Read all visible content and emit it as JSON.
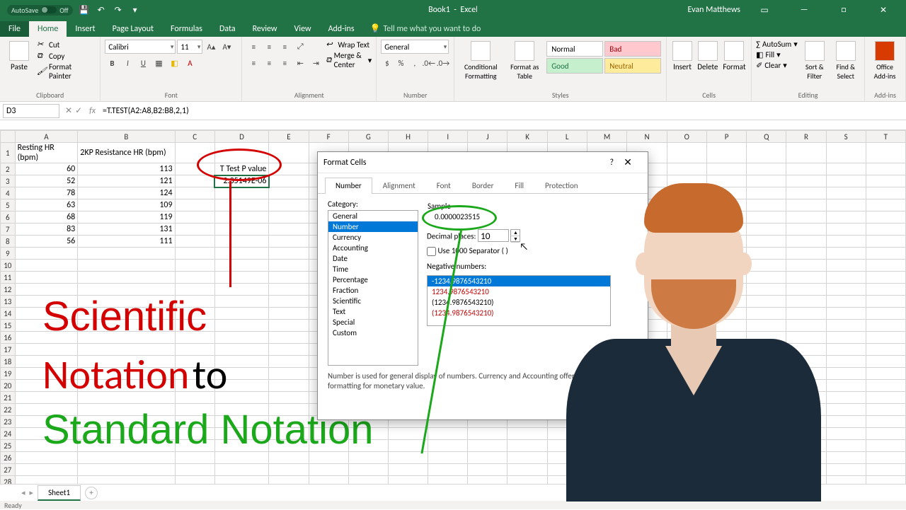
{
  "title": {
    "doc": "Book1",
    "app": "Excel",
    "user": "Evan Matthews",
    "autosave": "AutoSave",
    "autosave_state": "Off"
  },
  "tabs": {
    "file": "File",
    "home": "Home",
    "insert": "Insert",
    "pagelayout": "Page Layout",
    "formulas": "Formulas",
    "data": "Data",
    "review": "Review",
    "view": "View",
    "addins": "Add-ins",
    "tellme": "Tell me what you want to do"
  },
  "ribbon": {
    "clipboard": {
      "paste": "Paste",
      "cut": "Cut",
      "copy": "Copy",
      "painter": "Format Painter",
      "label": "Clipboard"
    },
    "font": {
      "name": "Calibri",
      "size": "11",
      "label": "Font"
    },
    "alignment": {
      "wrap": "Wrap Text",
      "merge": "Merge & Center",
      "label": "Alignment"
    },
    "number": {
      "format": "General",
      "label": "Number"
    },
    "styles": {
      "cond": "Conditional Formatting",
      "table": "Format as Table",
      "normal": "Normal",
      "bad": "Bad",
      "good": "Good",
      "neutral": "Neutral",
      "label": "Styles"
    },
    "cells": {
      "insert": "Insert",
      "delete": "Delete",
      "format": "Format",
      "label": "Cells"
    },
    "editing": {
      "autosum": "AutoSum",
      "fill": "Fill",
      "clear": "Clear",
      "sort": "Sort & Filter",
      "find": "Find & Select",
      "label": "Editing"
    },
    "addins": {
      "office": "Office Add-ins",
      "label": "Add-ins"
    }
  },
  "namebox": "D3",
  "formula": "=T.TEST(A2:A8,B2:B8,2,1)",
  "columns": [
    "A",
    "B",
    "C",
    "D",
    "E",
    "F",
    "G",
    "H",
    "I",
    "J",
    "K",
    "L",
    "M",
    "N",
    "O",
    "P",
    "Q",
    "R",
    "S",
    "T"
  ],
  "hdrA": "Resting HR (bpm)",
  "hdrB": "2KP Resistance HR (bpm)",
  "d2": "T Test P value",
  "d3": "2.35149E-06",
  "rows": [
    {
      "a": "60",
      "b": "113"
    },
    {
      "a": "52",
      "b": "121"
    },
    {
      "a": "78",
      "b": "124"
    },
    {
      "a": "63",
      "b": "109"
    },
    {
      "a": "68",
      "b": "119"
    },
    {
      "a": "83",
      "b": "131"
    },
    {
      "a": "56",
      "b": "111"
    }
  ],
  "dialog": {
    "title": "Format Cells",
    "tabs": {
      "number": "Number",
      "alignment": "Alignment",
      "font": "Font",
      "border": "Border",
      "fill": "Fill",
      "protection": "Protection"
    },
    "category_label": "Category:",
    "categories": [
      "General",
      "Number",
      "Currency",
      "Accounting",
      "Date",
      "Time",
      "Percentage",
      "Fraction",
      "Scientific",
      "Text",
      "Special",
      "Custom"
    ],
    "selected_category": "Number",
    "sample_label": "Sample",
    "sample_value": "0.0000023515",
    "decimal_label": "Decimal places:",
    "decimal_value": "10",
    "sep_label": "Use 1000 Separator ( )",
    "neg_label": "Negative numbers:",
    "neg_items": [
      "-1234.9876543210",
      "1234.9876543210",
      "(1234.9876543210)",
      "(1234.9876543210)"
    ],
    "desc": "Number is used for general display of numbers.  Currency and Accounting offer specialized formatting for monetary value."
  },
  "overlay": {
    "l1": "Scientific",
    "l2a": "Notation",
    "l2b": "to",
    "l3": "Standard Notation"
  },
  "sheet_tab": "Sheet1",
  "status": "Ready"
}
